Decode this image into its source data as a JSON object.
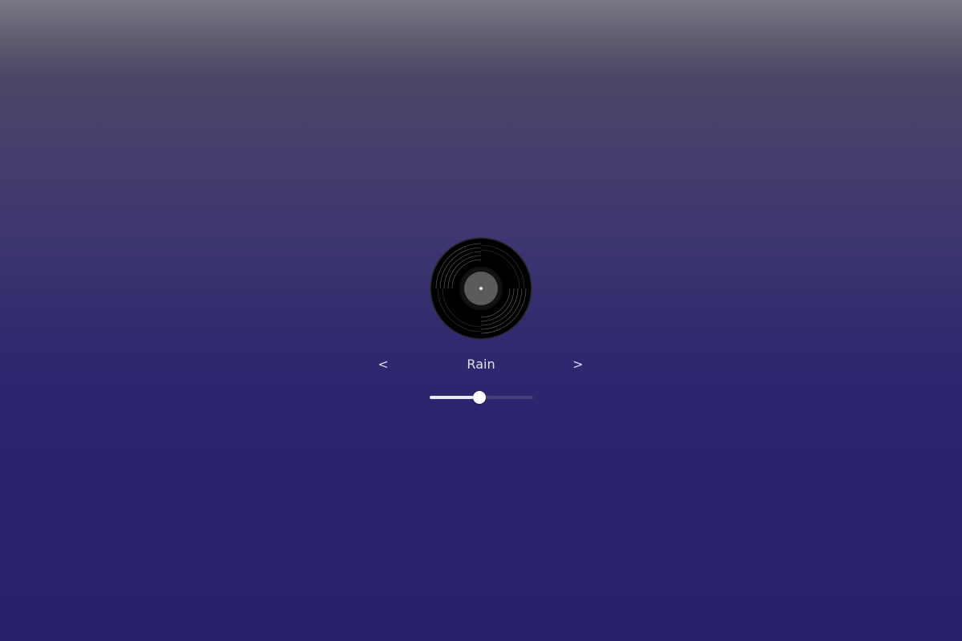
{
  "player": {
    "track_title": "Rain",
    "prev_label": "<",
    "next_label": ">",
    "volume_level": 0.48,
    "record_icon": "vinyl-record-icon"
  },
  "colors": {
    "background_top": "#7c7785",
    "background_bottom": "#28216a",
    "text": "#e2e0f2",
    "slider_fill": "#ecebf5",
    "slider_track": "#47417a",
    "record_label": "#5a5a5a"
  }
}
